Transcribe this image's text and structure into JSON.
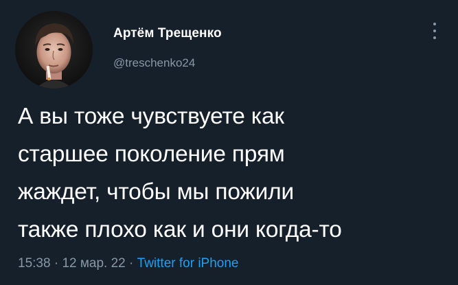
{
  "tweet": {
    "author": {
      "name": "Артём Трещенко",
      "handle": "@treschenko24"
    },
    "text_lines": [
      "А вы тоже чувствуете как",
      "старшее поколение прям",
      "жаждет, чтобы мы пожили",
      "также плохо как и они когда-то"
    ],
    "time": "15:38",
    "separator": "·",
    "date": "12 мар. 22",
    "source": "Twitter for iPhone"
  },
  "icons": {
    "more": "more-vertical-icon",
    "avatar": "profile-photo"
  },
  "colors": {
    "background": "#15202b",
    "text": "#ffffff",
    "secondary_text": "#8899a6",
    "link": "#1da1f2"
  }
}
